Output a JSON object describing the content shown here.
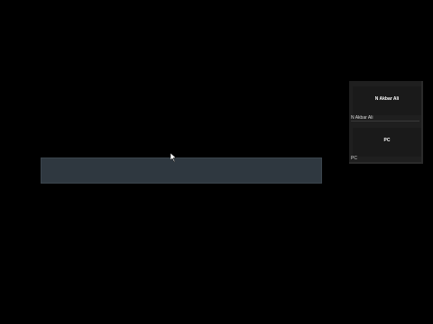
{
  "colors": {
    "background": "#000000",
    "input_bar": "#2f3840",
    "panel": "#1f1f1f",
    "tile": "#1a1a1a",
    "text": "#ffffff"
  },
  "cursor": {
    "icon": "mouse-pointer-icon"
  },
  "user_panel": {
    "accounts": [
      {
        "tile_name": "N Akbar Ali",
        "row_label": "N Akbar Ali"
      },
      {
        "tile_name": "PC",
        "row_label": "PC"
      }
    ]
  }
}
